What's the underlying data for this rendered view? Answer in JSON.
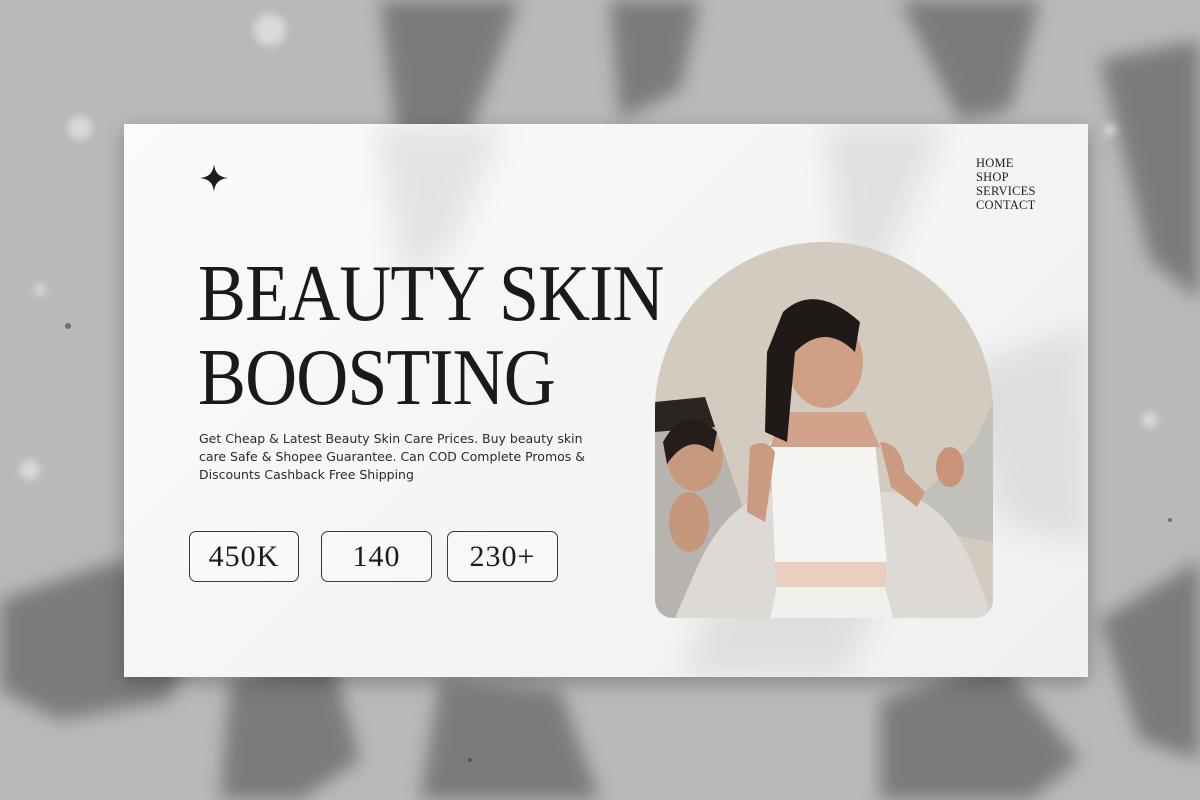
{
  "nav": {
    "items": [
      "HOME",
      "SHOP",
      "SERVICES",
      "CONTACT"
    ]
  },
  "hero": {
    "title_line1": "BEAUTY SKIN",
    "title_line2": "BOOSTING",
    "description": "Get Cheap & Latest Beauty Skin Care Prices. Buy beauty skin care Safe & Shopee Guarantee. Can COD Complete Promos & Discounts Cashback Free Shipping"
  },
  "stats": [
    "450K",
    "140",
    "230+"
  ],
  "icons": {
    "logo": "four-point-star-icon"
  },
  "colors": {
    "card_background": "#f7f7f7",
    "text": "#1a1a1a",
    "wall": "#b7b7b5",
    "photo_background": "#d6ccc1"
  }
}
